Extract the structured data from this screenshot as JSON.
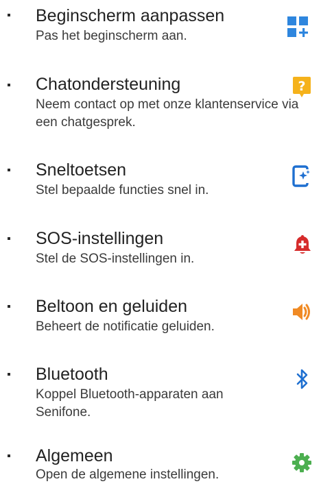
{
  "items": [
    {
      "title": "Beginscherm aanpassen",
      "description": "Pas het beginscherm aan.",
      "icon": "homescreen-grid-plus-icon",
      "color": "#2E86DE"
    },
    {
      "title": "Chatondersteuning",
      "description": "Neem contact op met onze klantenservice via een chatgesprek.",
      "icon": "chat-question-icon",
      "color": "#F5B21B"
    },
    {
      "title": "Sneltoetsen",
      "description": "Stel bepaalde functies snel in.",
      "icon": "shortcut-phone-sparkle-icon",
      "color": "#1E6FD0"
    },
    {
      "title": "SOS-instellingen",
      "description": "Stel de SOS-instellingen in.",
      "icon": "sos-bell-icon",
      "color": "#D62B2B"
    },
    {
      "title": "Beltoon en geluiden",
      "description": "Beheert de notificatie geluiden.",
      "icon": "speaker-volume-icon",
      "color": "#F08A24"
    },
    {
      "title": "Bluetooth",
      "description": "Koppel Bluetooth-apparaten aan Senifone.",
      "icon": "bluetooth-icon",
      "color": "#1E6FD0"
    },
    {
      "title": "Algemeen",
      "description": "Open de algemene instellingen.",
      "icon": "gear-icon",
      "color": "#4CAF50"
    }
  ]
}
